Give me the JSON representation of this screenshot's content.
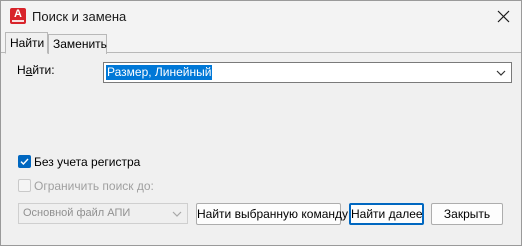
{
  "window": {
    "title": "Поиск и замена",
    "app_icon_letter": "A"
  },
  "tabs": [
    {
      "label": "Найти",
      "active": true
    },
    {
      "label": "Заменить",
      "active": false
    }
  ],
  "find": {
    "label_prefix": "Н",
    "label_accel": "а",
    "label_suffix": "йти:",
    "value": "Размер, Линейный"
  },
  "options": {
    "ignore_case": {
      "label": "Без учета регистра",
      "checked": true,
      "enabled": true
    },
    "limit_search": {
      "label": "Ограничить поиск до:",
      "checked": false,
      "enabled": false
    }
  },
  "scope": {
    "value": "Основной файл АПИ",
    "enabled": false
  },
  "buttons": {
    "find_selected": "Найти выбранную команду",
    "find_next": "Найти далее",
    "close": "Закрыть"
  },
  "colors": {
    "accent": "#0067c0",
    "selection": "#0078d7",
    "app_icon": "#d8232a"
  }
}
